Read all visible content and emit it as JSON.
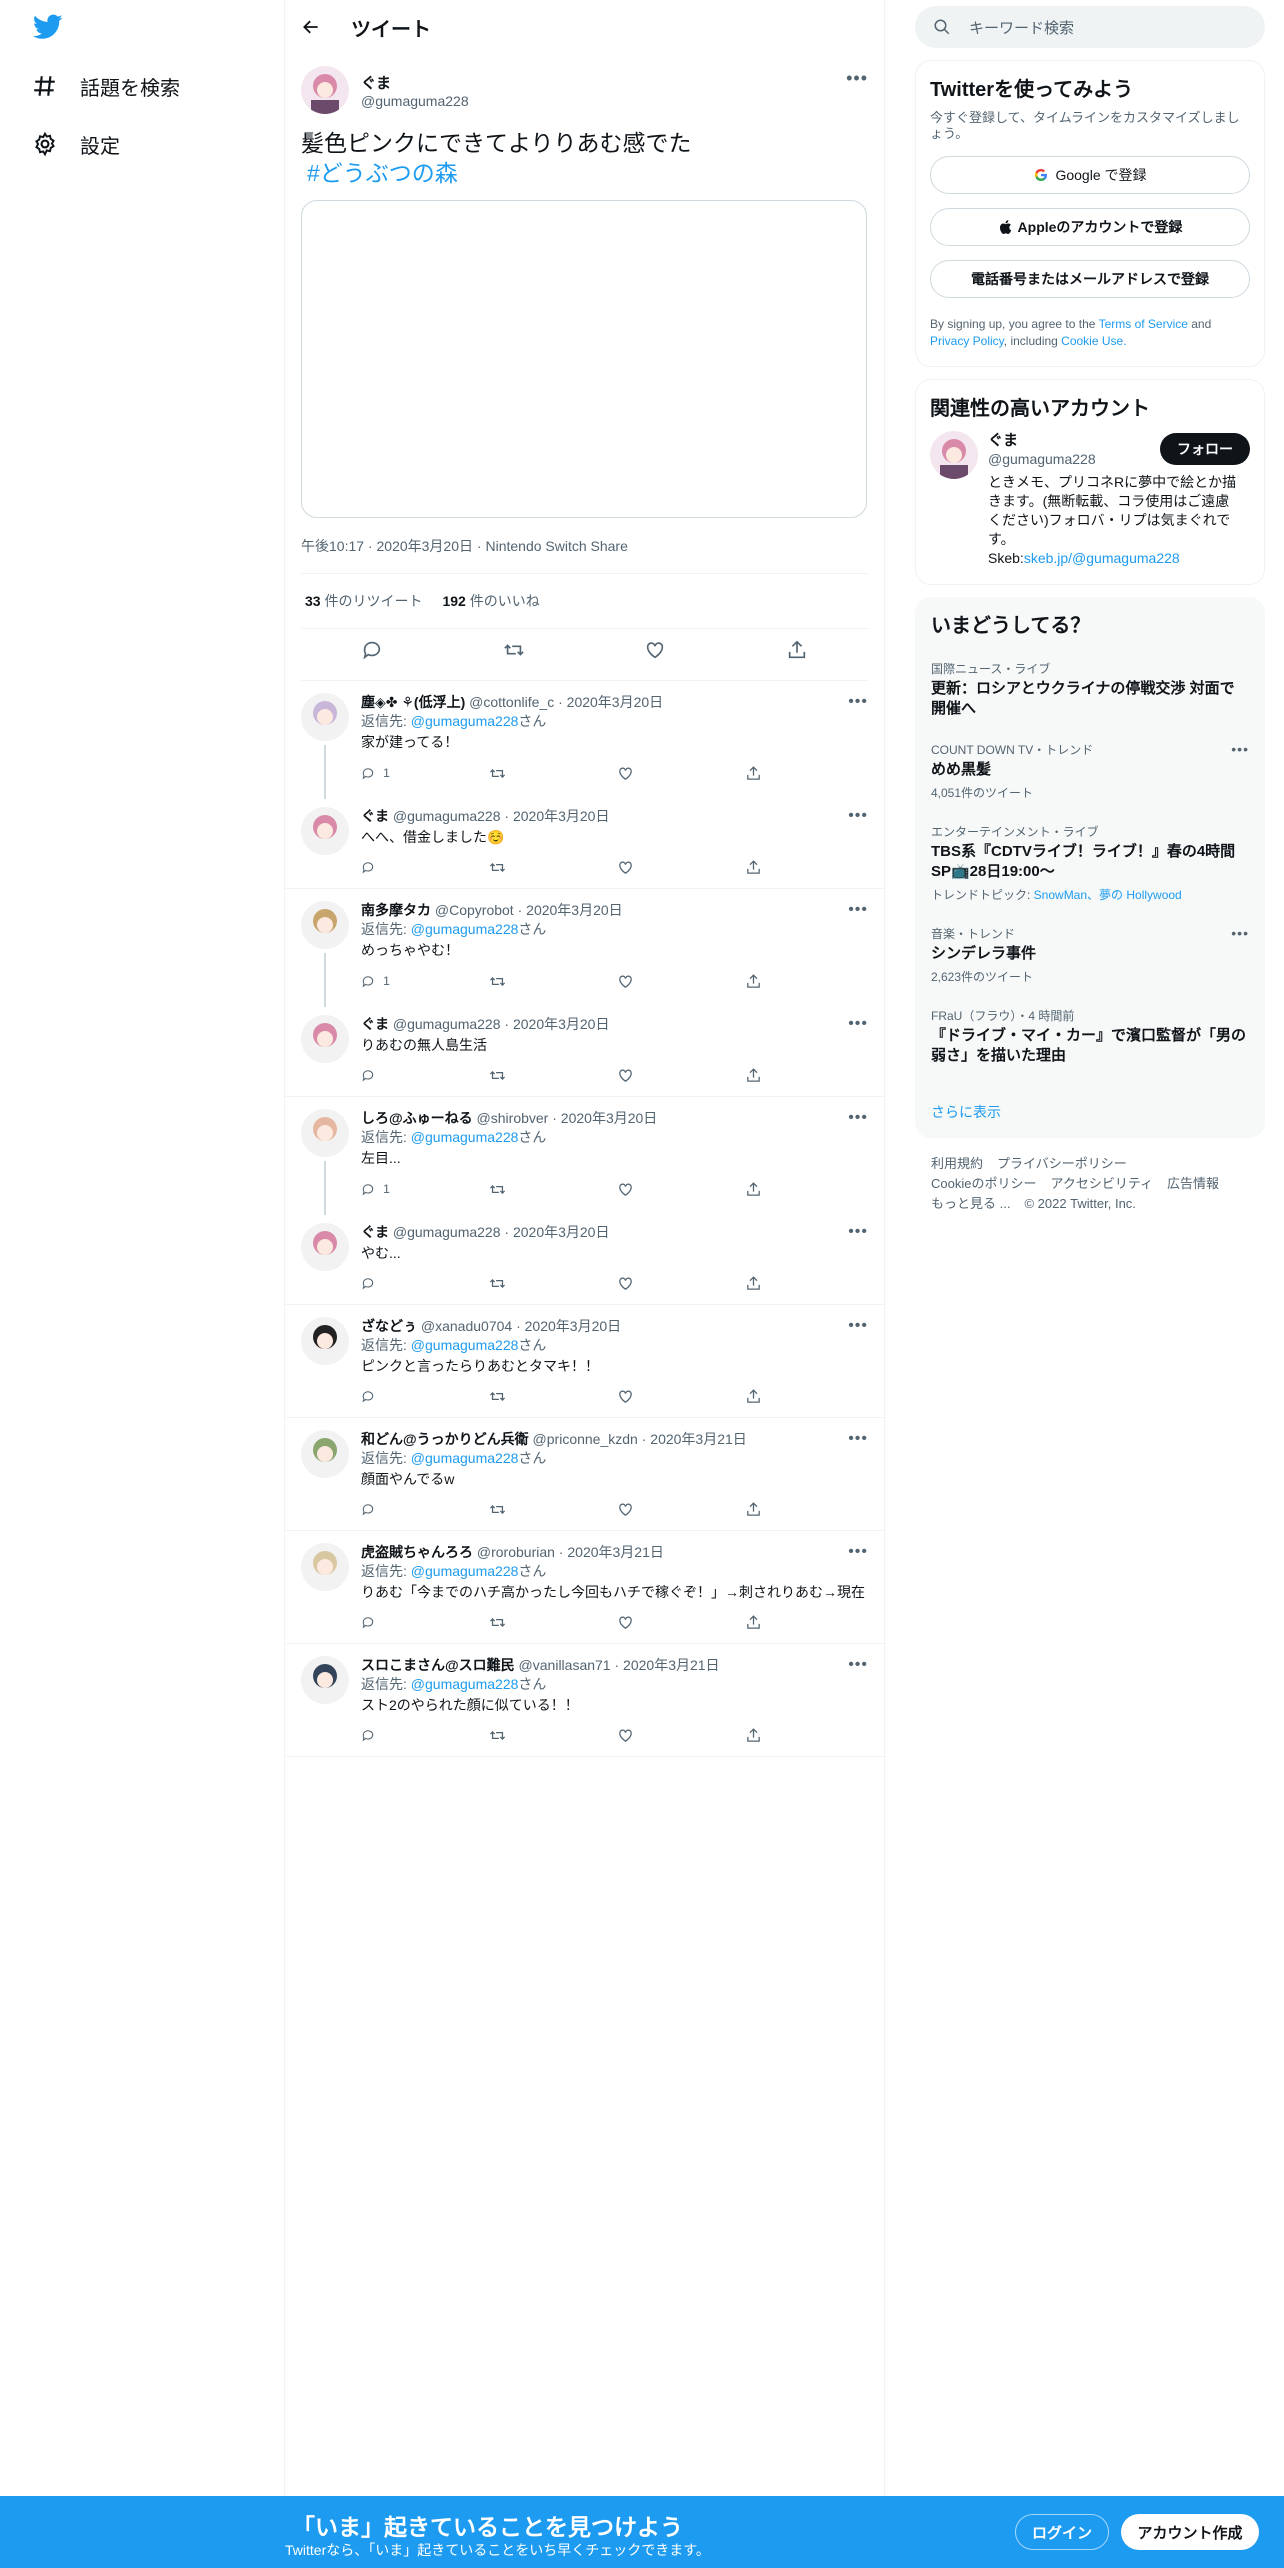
{
  "nav": {
    "explore_label": "話題を検索",
    "settings_label": "設定"
  },
  "header": {
    "title": "ツイート"
  },
  "main_tweet": {
    "author_name": "ぐま",
    "author_handle": "@gumaguma228",
    "text": "髪色ピンクにできてよりりあむ感でた",
    "hashtag": "#どうぶつの森",
    "time": "午後10:17",
    "date": "2020年3月20日",
    "source": "Nintendo Switch Share",
    "retweets_count": "33",
    "retweets_label": " 件のリツイート",
    "likes_count": "192",
    "likes_label": " 件のいいね"
  },
  "replies": [
    {
      "name": "塵◈✤ ⚘(低浮上)",
      "handle": "@cottonlife_c",
      "date": "2020年3月20日",
      "reply_prefix": "返信先: ",
      "reply_to": "@gumaguma228",
      "reply_suffix": "さん",
      "text": "家が建ってる！",
      "reply_count": "1",
      "avatar_color": "#c8b7d8"
    },
    {
      "name": "ぐま",
      "handle": "@gumaguma228",
      "date": "2020年3月20日",
      "text": "へへ、借金しました☺️",
      "reply_count": "",
      "avatar_color": "#d98aa8"
    },
    {
      "name": "南多摩タカ",
      "handle": "@Copyrobot",
      "date": "2020年3月20日",
      "reply_prefix": "返信先: ",
      "reply_to": "@gumaguma228",
      "reply_suffix": "さん",
      "text": "めっちゃやむ！",
      "reply_count": "1",
      "avatar_color": "#c9a56e"
    },
    {
      "name": "ぐま",
      "handle": "@gumaguma228",
      "date": "2020年3月20日",
      "text": "りあむの無人島生活",
      "reply_count": "",
      "avatar_color": "#d98aa8"
    },
    {
      "name": "しろ@ふゅーねる",
      "handle": "@shirobver",
      "date": "2020年3月20日",
      "reply_prefix": "返信先: ",
      "reply_to": "@gumaguma228",
      "reply_suffix": "さん",
      "text": "左目...",
      "reply_count": "1",
      "avatar_color": "#e6b7a0"
    },
    {
      "name": "ぐま",
      "handle": "@gumaguma228",
      "date": "2020年3月20日",
      "text": "やむ...",
      "reply_count": "",
      "avatar_color": "#d98aa8"
    },
    {
      "name": "ざなどぅ",
      "handle": "@xanadu0704",
      "date": "2020年3月20日",
      "reply_prefix": "返信先: ",
      "reply_to": "@gumaguma228",
      "reply_suffix": "さん",
      "text": "ピンクと言ったらりあむとタマキ！！",
      "reply_count": "",
      "avatar_color": "#222222"
    },
    {
      "name": "和どん@うっかりどん兵衛",
      "handle": "@priconne_kzdn",
      "date": "2020年3月21日",
      "reply_prefix": "返信先: ",
      "reply_to": "@gumaguma228",
      "reply_suffix": "さん",
      "text": "顔面やんでるw",
      "reply_count": "",
      "avatar_color": "#8aa56e"
    },
    {
      "name": "虎盗賊ちゃんろろ",
      "handle": "@roroburian",
      "date": "2020年3月21日",
      "reply_prefix": "返信先: ",
      "reply_to": "@gumaguma228",
      "reply_suffix": "さん",
      "text": "りあむ「今までのハチ高かったし今回もハチで稼ぐぞ！」→刺されりあむ→現在",
      "reply_count": "",
      "avatar_color": "#d8c7a0"
    },
    {
      "name": "スロこまさん@スロ難民",
      "handle": "@vanillasan71",
      "date": "2020年3月21日",
      "reply_prefix": "返信先: ",
      "reply_to": "@gumaguma228",
      "reply_suffix": "さん",
      "text": "スト2のやられた顔に似ている！！",
      "reply_count": "",
      "avatar_color": "#33445a"
    }
  ],
  "search": {
    "placeholder": "キーワード検索"
  },
  "signup_card": {
    "title": "Twitterを使ってみよう",
    "subtitle": "今すぐ登録して、タイムラインをカスタマイズしましょう。",
    "google_label": "Google で登録",
    "apple_label": "Appleのアカウントで登録",
    "phone_label": "電話番号またはメールアドレスで登録",
    "terms_prefix": "By signing up, you agree to the ",
    "terms_link": "Terms of Service",
    "terms_and": " and ",
    "privacy_link": "Privacy Policy",
    "terms_including": ", including ",
    "cookie_link": "Cookie Use."
  },
  "related": {
    "title": "関連性の高いアカウント",
    "name": "ぐま",
    "handle": "@gumaguma228",
    "follow_label": "フォロー",
    "bio": "ときメモ、プリコネRに夢中で絵とか描きます。(無断転載、コラ使用はご遠慮ください)フォロバ・リプは気まぐれです。",
    "bio_link_prefix": "Skeb:",
    "bio_link": "skeb.jp/@gumaguma228"
  },
  "trends": {
    "title": "いまどうしてる？",
    "items": [
      {
        "category": "国際ニュース・ライブ",
        "name": "更新：ロシアとウクライナの停戦交渉 対面で開催へ",
        "count": ""
      },
      {
        "category": "COUNT DOWN TV・トレンド",
        "name": "めめ黒髪",
        "count": "4,051件のツイート"
      },
      {
        "category": "エンターテインメント・ライブ",
        "name": "TBS系『CDTVライブ！ライブ！』春の4時間SP📺28日19:00〜",
        "topic_prefix": "トレンドトピック: ",
        "topics": "SnowMan、夢の Hollywood",
        "count": ""
      },
      {
        "category": "音楽・トレンド",
        "name": "シンデレラ事件",
        "count": "2,623件のツイート"
      },
      {
        "category": "FRaU（フラウ）",
        "time": "・4 時間前",
        "name": "『ドライブ・マイ・カー』で濱口監督が「男の弱さ」を描いた理由",
        "count": ""
      }
    ],
    "show_more": "さらに表示"
  },
  "footer": {
    "links": [
      "利用規約",
      "プライバシーポリシー",
      "Cookieのポリシー",
      "アクセシビリティ",
      "広告情報",
      "もっと見る ..."
    ],
    "copyright": "© 2022 Twitter, Inc."
  },
  "banner": {
    "headline": "「いま」起きていることを見つけよう",
    "sub": "Twitterなら、「いま」起きていることをいち早くチェックできます。",
    "login_label": "ログイン",
    "signup_label": "アカウント作成"
  },
  "colors": {
    "accent": "#1d9bf0",
    "text": "#0f1419",
    "muted": "#536471"
  }
}
